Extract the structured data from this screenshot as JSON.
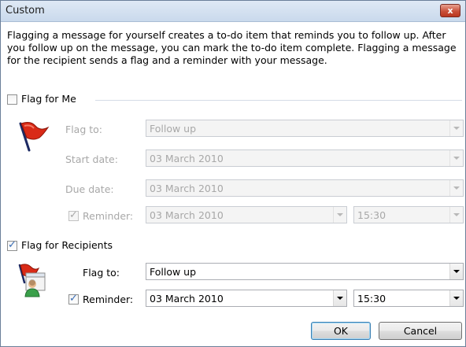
{
  "window": {
    "title": "Custom",
    "close_glyph": "x"
  },
  "description": "Flagging a message for yourself creates a to-do item that reminds you to follow up. After you follow up on the message, you can mark the to-do item complete. Flagging a message for the recipient sends a flag and a reminder with your message.",
  "flag_for_me": {
    "label": "Flag for Me",
    "checked": false,
    "icon": "red-flag-icon",
    "flag_to_label": "Flag to:",
    "flag_to_value": "Follow up",
    "start_date_label": "Start date:",
    "start_date_value": "03 March 2010",
    "due_date_label": "Due date:",
    "due_date_value": "03 March 2010",
    "reminder_label": "Reminder:",
    "reminder_checked": true,
    "reminder_date": "03 March 2010",
    "reminder_time": "15:30"
  },
  "flag_for_recipients": {
    "label": "Flag for Recipients",
    "checked": true,
    "icon": "recipient-flag-icon",
    "flag_to_label": "Flag to:",
    "flag_to_value": "Follow up",
    "reminder_label": "Reminder:",
    "reminder_checked": true,
    "reminder_date": "03 March 2010",
    "reminder_time": "15:30"
  },
  "buttons": {
    "ok": "OK",
    "cancel": "Cancel"
  }
}
